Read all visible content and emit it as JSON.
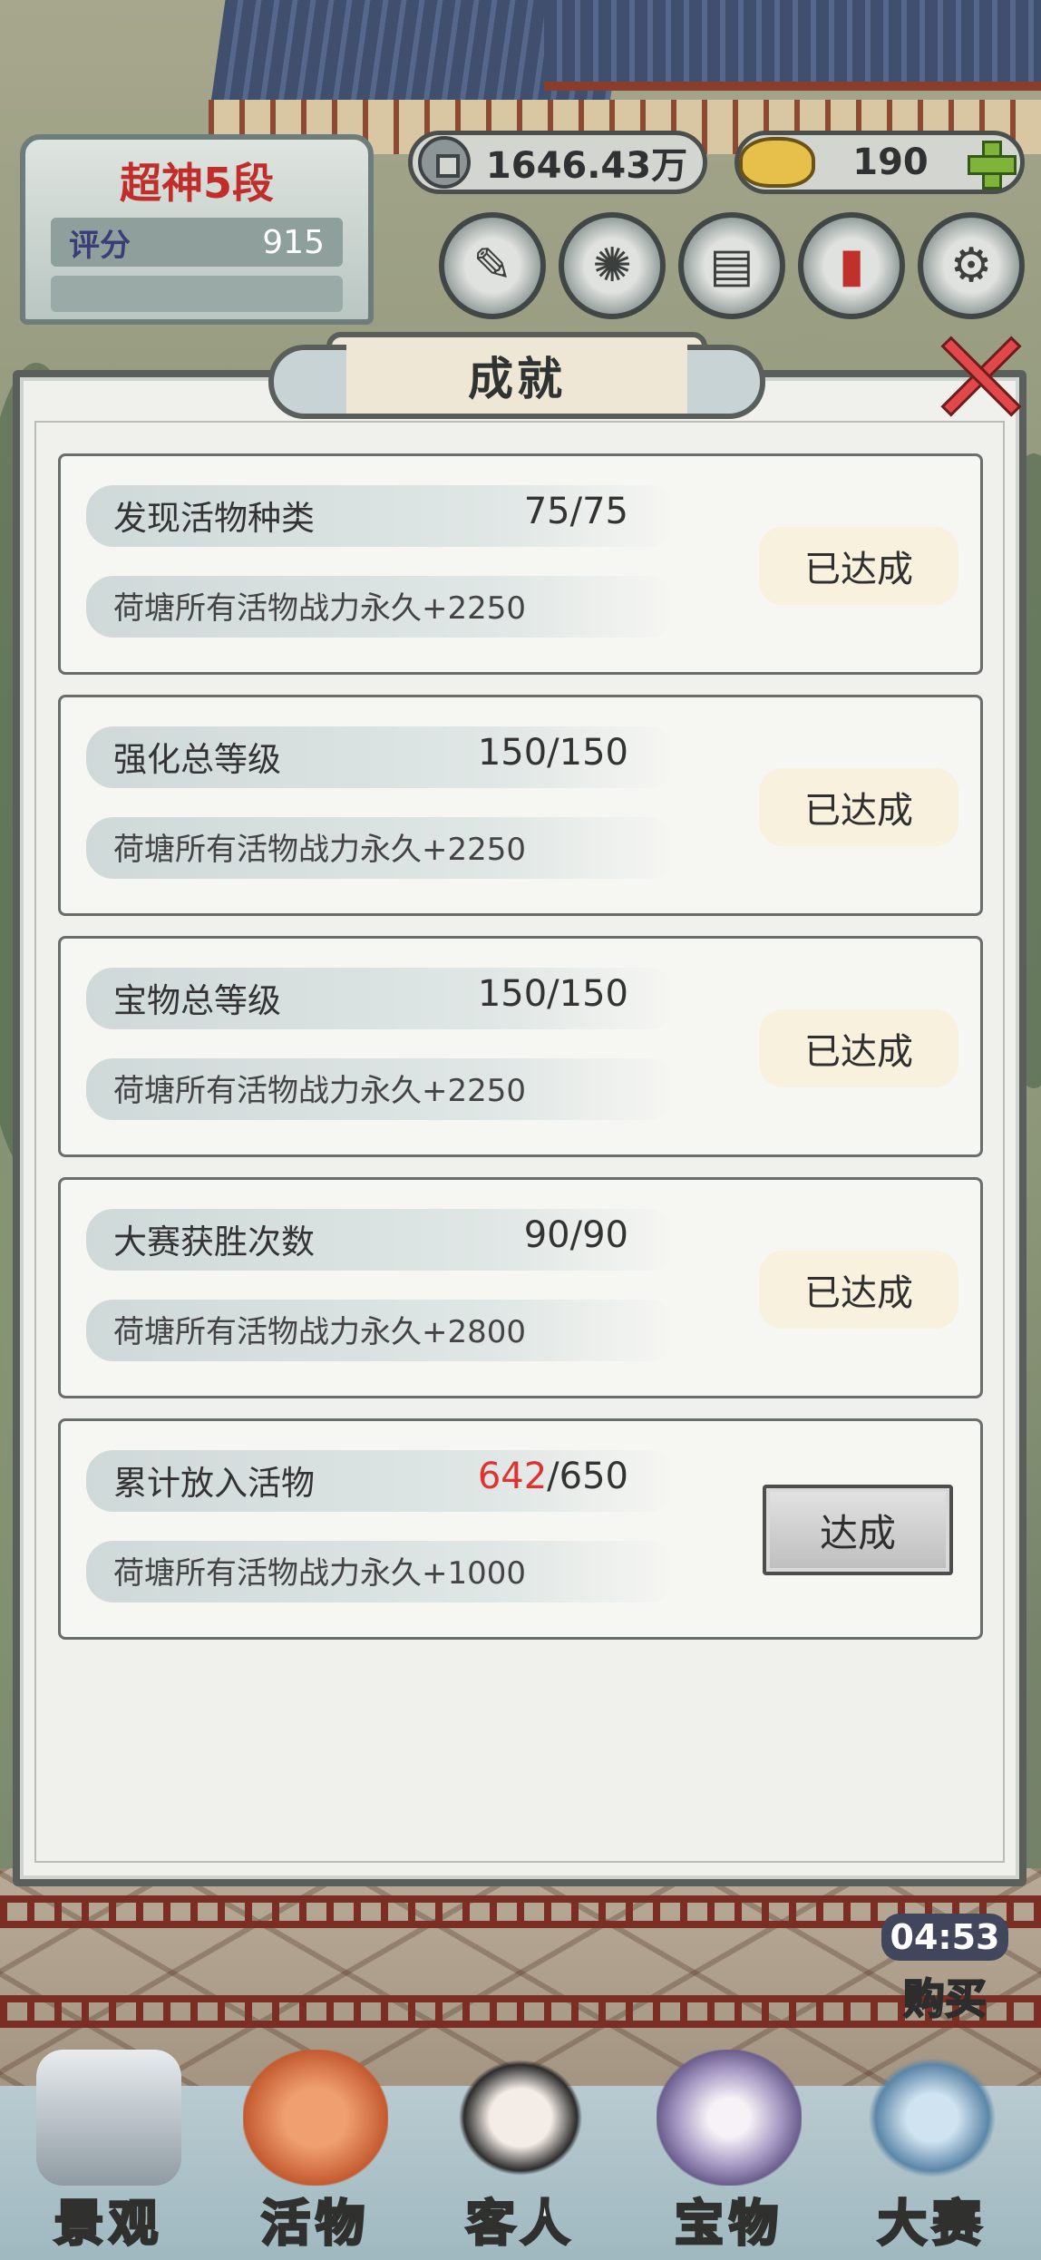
{
  "hud": {
    "rank_title": "超神5段",
    "score_label": "评分",
    "score_value": "915",
    "coins": "1646.43万",
    "gold": "190"
  },
  "modal": {
    "title": "成就"
  },
  "achievements": [
    {
      "name": "发现活物种类",
      "current": "75",
      "total": "/75",
      "reward": "荷塘所有活物战力永久+2250",
      "button": "已达成"
    },
    {
      "name": "强化总等级",
      "current": "150",
      "total": "/150",
      "reward": "荷塘所有活物战力永久+2250",
      "button": "已达成"
    },
    {
      "name": "宝物总等级",
      "current": "150",
      "total": "/150",
      "reward": "荷塘所有活物战力永久+2250",
      "button": "已达成"
    },
    {
      "name": "大赛获胜次数",
      "current": "90",
      "total": "/90",
      "reward": "荷塘所有活物战力永久+2800",
      "button": "已达成"
    },
    {
      "name": "累计放入活物",
      "current": "642",
      "total": "/650",
      "reward": "荷塘所有活物战力永久+1000",
      "button": "达成"
    }
  ],
  "timer": {
    "time": "04:53",
    "label": "购买"
  },
  "nav": [
    {
      "label": "景观",
      "icon": "rock-icon"
    },
    {
      "label": "活物",
      "icon": "koi-icon"
    },
    {
      "label": "客人",
      "icon": "guest-icon"
    },
    {
      "label": "宝物",
      "icon": "shell-icon"
    },
    {
      "label": "大赛",
      "icon": "fish-trophy-icon"
    }
  ],
  "colors": {
    "accent_red": "#e0322f",
    "rank_red": "#c02d2a",
    "panel": "#f0f0ec",
    "done_button": "#f8f1de"
  }
}
